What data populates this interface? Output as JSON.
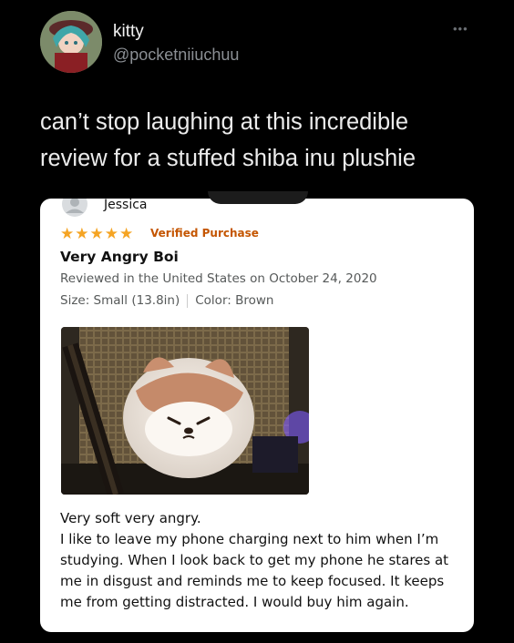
{
  "tweet": {
    "name": "kitty",
    "handle": "@pocketniiuchuu",
    "more_icon": "more-icon",
    "text": "can’t stop laughing at this incredible review for a stuffed shiba inu plushie"
  },
  "review": {
    "reviewer": "Jessica",
    "rating": 5,
    "verified": "Verified Purchase",
    "title": "Very Angry Boi",
    "date_line": "Reviewed in the United States on October 24, 2020",
    "size": "Size: Small (13.8in)",
    "color": "Color: Brown",
    "body_line1": "Very soft very angry.",
    "body_line2": "I like to leave my phone charging next to him when I’m studying. When I look back to get my phone he stares at me in disgust and reminds me to keep focused. It keeps me from getting distracted. I would buy him again.",
    "star_color": "#f5a423"
  }
}
